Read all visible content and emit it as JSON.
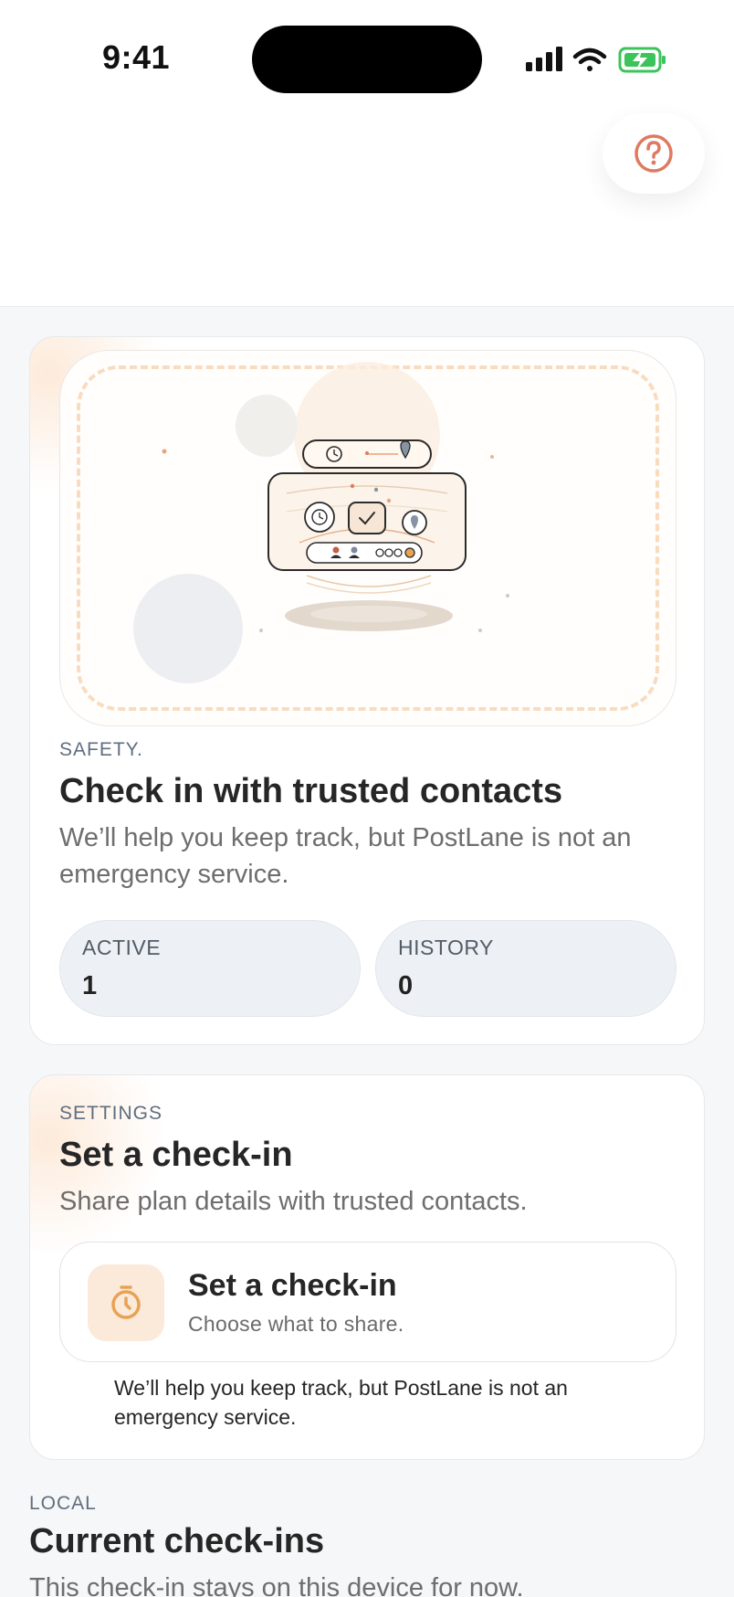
{
  "status_bar": {
    "time": "9:41",
    "icons": [
      "cellular-signal-icon",
      "wifi-icon",
      "battery-charging-icon"
    ]
  },
  "header": {
    "help_icon": "question-circle-icon",
    "accent_color": "#de7a60"
  },
  "safety_card": {
    "eyebrow": "SAFETY.",
    "title": "Check in with trusted contacts",
    "description": "We’ll help you keep track, but PostLane is not an emergency service.",
    "illustration": "check-in-illustration",
    "stats": [
      {
        "label": "ACTIVE",
        "value": "1"
      },
      {
        "label": "HISTORY",
        "value": "0"
      }
    ]
  },
  "settings_card": {
    "eyebrow": "SETTINGS",
    "title": "Set a check-in",
    "description": "Share plan details with trusted contacts.",
    "action": {
      "icon": "timer-icon",
      "title": "Set a check-in",
      "subtitle": "Choose what to share."
    },
    "note": "We’ll help you keep track, but PostLane is not an emergency service.",
    "accent_color": "#e8a253"
  },
  "local_section": {
    "eyebrow": "LOCAL",
    "title": "Current check-ins",
    "description": "This check-in stays on this device for now."
  }
}
